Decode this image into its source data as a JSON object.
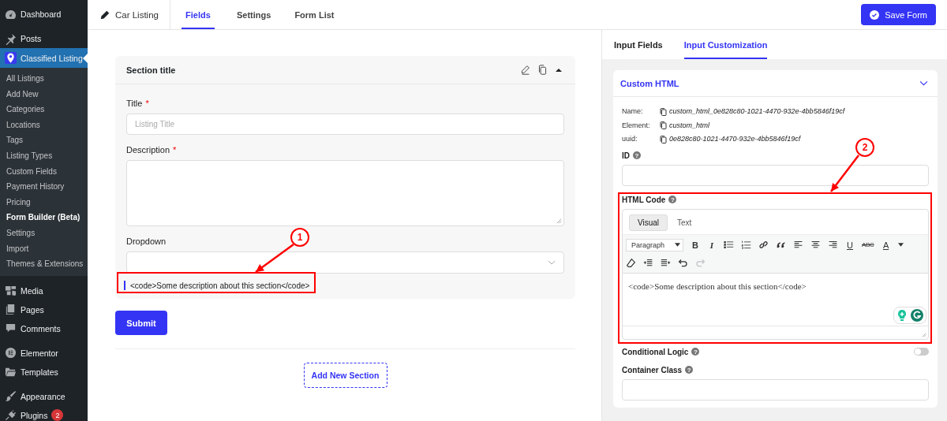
{
  "sidebar": {
    "groups": [
      {
        "items": [
          {
            "label": "Dashboard",
            "selected": false
          }
        ]
      },
      {
        "items": [
          {
            "label": "Posts",
            "selected": false
          },
          {
            "label": "Classified Listing",
            "selected": true,
            "children": [
              {
                "label": "All Listings",
                "selected": false
              },
              {
                "label": "Add New",
                "selected": false
              },
              {
                "label": "Categories",
                "selected": false
              },
              {
                "label": "Locations",
                "selected": false
              },
              {
                "label": "Tags",
                "selected": false
              },
              {
                "label": "Listing Types",
                "selected": false
              },
              {
                "label": "Custom Fields",
                "selected": false
              },
              {
                "label": "Payment History",
                "selected": false
              },
              {
                "label": "Pricing",
                "selected": false
              },
              {
                "label": "Form Builder (Beta)",
                "selected": true
              },
              {
                "label": "Settings",
                "selected": false
              },
              {
                "label": "Import",
                "selected": false
              },
              {
                "label": "Themes & Extensions",
                "selected": false
              }
            ]
          }
        ]
      },
      {
        "items": [
          {
            "label": "Media",
            "selected": false
          },
          {
            "label": "Pages",
            "selected": false
          },
          {
            "label": "Comments",
            "selected": false
          }
        ]
      },
      {
        "items": [
          {
            "label": "Elementor",
            "selected": false
          },
          {
            "label": "Templates",
            "selected": false
          }
        ]
      },
      {
        "items": [
          {
            "label": "Appearance",
            "selected": false
          },
          {
            "label": "Plugins",
            "selected": false,
            "badge": "2"
          }
        ]
      }
    ]
  },
  "top_bar": {
    "form_name": "Car Listing",
    "tabs": [
      {
        "label": "Fields",
        "selected": true
      },
      {
        "label": "Settings",
        "selected": false
      },
      {
        "label": "Form List",
        "selected": false
      }
    ],
    "save_button": "Save Form"
  },
  "builder": {
    "section": {
      "title": "Section title",
      "expanded": true,
      "required_mark": "*",
      "fields": [
        {
          "kind": "text",
          "label": "Title",
          "required": true,
          "placeholder": "Listing Title"
        },
        {
          "kind": "textarea",
          "label": "Description",
          "required": true
        },
        {
          "kind": "select",
          "label": "Dropdown",
          "required": false
        }
      ],
      "description": "<code>Some description about this section</code>"
    },
    "submit_button": "Submit",
    "add_section_button": "Add New Section"
  },
  "panel": {
    "tabs": [
      {
        "label": "Input Fields",
        "selected": false
      },
      {
        "label": "Input Customization",
        "selected": true
      }
    ],
    "element": {
      "title": "Custom HTML",
      "expanded": true,
      "meta": [
        {
          "label": "Name:",
          "value": "custom_html_0e828c80-1021-4470-932e-4bb5846f19cf"
        },
        {
          "label": "Element:",
          "value": "custom_html"
        },
        {
          "label": "uuid:",
          "value": "0e828c80-1021-4470-932e-4bb5846f19cf"
        }
      ],
      "fields": [
        {
          "kind": "input",
          "label": "ID",
          "help": "?"
        },
        {
          "kind": "editor",
          "label": "HTML Code",
          "help": "?"
        },
        {
          "kind": "toggle",
          "label": "Conditional Logic",
          "help": "?",
          "on": false
        },
        {
          "kind": "input",
          "label": "Container Class",
          "help": "?"
        }
      ]
    },
    "editor": {
      "modes": [
        {
          "label": "Visual",
          "selected": true
        },
        {
          "label": "Text",
          "selected": false
        }
      ],
      "format": "Paragraph",
      "bold": "B",
      "italic": "I",
      "underline": "U",
      "strikethrough": "ABC",
      "text_color": "A",
      "redo_disabled": true,
      "content": "<code>Some description about this section</code>"
    }
  },
  "annotations": [
    {
      "number": "1"
    },
    {
      "number": "2"
    }
  ]
}
